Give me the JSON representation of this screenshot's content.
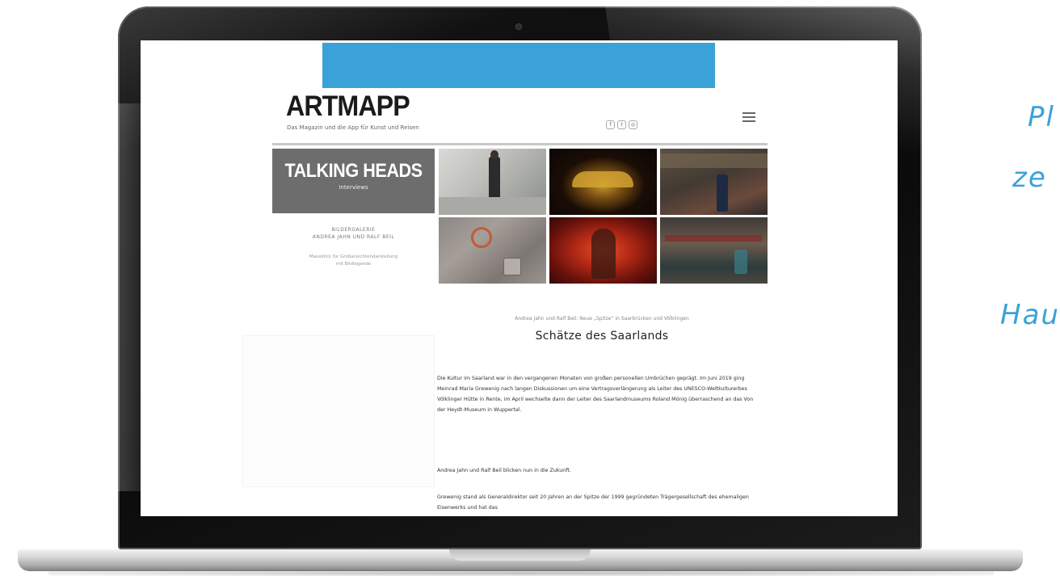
{
  "side_text": {
    "line1": "Pl",
    "line2": "ze",
    "line3": "Hau"
  },
  "site": {
    "logo": "ARTMAPP",
    "tagline": "Das Magazin und die App für Kunst und Reisen",
    "social_icons": [
      "facebook-icon",
      "twitter-icon",
      "instagram-icon"
    ],
    "talking_heads": {
      "title": "TALKING HEADS",
      "subtitle": "Interviews"
    },
    "gallery_label_1": "BILDERGALERIE",
    "gallery_label_2": "ANDREA JAHN UND RALF BEIL",
    "gallery_note_1": "Mausklick für Großansichtendarstellung",
    "gallery_note_2": "mit Bildlegende",
    "article": {
      "caption": "Andrea Jahn und Ralf Beil: Neue „Spitze“ in Saarbrücken und Völklingen",
      "headline": "Schätze des Saarlands",
      "paragraph1": "Die Kultur im Saarland war in den vergangenen Monaten von großen personellen Umbrüchen geprägt. Im Juni 2019 ging Meinrad Maria Grewenig nach langen Diskussionen um eine Vertragsverlängerung als Leiter des UNESCO-Weltkulturerbes Völklinger Hütte in Rente, im April wechselte dann der Leiter des Saarlandmuseums Roland Mönig überraschend an das Von der Heydt-Museum in Wuppertal.",
      "paragraph2": "Andrea Jahn und Ralf Beil blicken nun in die Zukunft.",
      "paragraph3": "Grewenig stand als Generaldirektor seit 20 Jahren an der Spitze der 1999 gegründeten Trägergesellschaft des ehemaligen Eisenwerks und hat das"
    }
  },
  "colors": {
    "accent_blue": "#3aa2d8",
    "talking_heads_bg": "#6d6d6d"
  }
}
